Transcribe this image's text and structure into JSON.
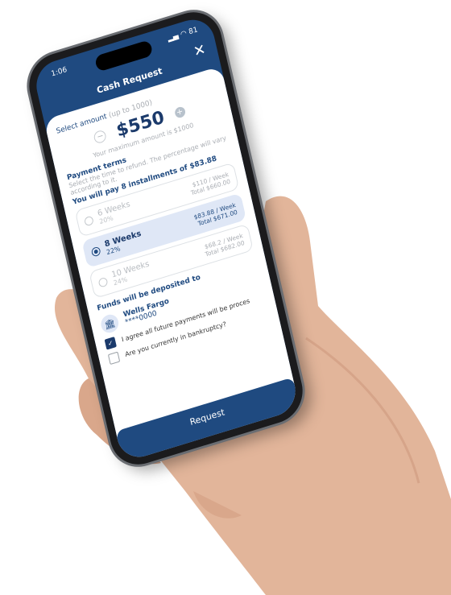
{
  "status_bar": {
    "time": "1:06",
    "battery": "81"
  },
  "header": {
    "title": "Cash Request",
    "close_label": "✕"
  },
  "amount": {
    "label": "Select amount",
    "hint": "(up to 1000)",
    "value": "$550",
    "decrement": "−",
    "increment": "+",
    "max_note": "Your maximum amount is $1000"
  },
  "terms": {
    "title": "Payment terms",
    "description": "Select the time to refund. The percentage will vary according to it.",
    "summary": "You will pay 8 installments of $83.88",
    "options": [
      {
        "weeks": "6 Weeks",
        "percent": "20%",
        "per_week": "$110 / Week",
        "total": "Total $660.00",
        "selected": false
      },
      {
        "weeks": "8 Weeks",
        "percent": "22%",
        "per_week": "$83.88 / Week",
        "total": "Total $671.00",
        "selected": true
      },
      {
        "weeks": "10 Weeks",
        "percent": "24%",
        "per_week": "$68.2 / Week",
        "total": "Total $682.00",
        "selected": false
      }
    ]
  },
  "deposit": {
    "title": "Funds will be deposited to",
    "bank_name": "Wells Fargo",
    "account": "****0000",
    "icon": "bank-icon"
  },
  "agreements": [
    {
      "label": "I agree all future payments will be proces",
      "checked": true
    },
    {
      "label": "Are you currently in bankruptcy?",
      "checked": false
    }
  ],
  "submit_label": "Request",
  "colors": {
    "brand": "#1f4a80",
    "selected_bg": "#dfe7f6",
    "skin": "#e2b59a"
  }
}
